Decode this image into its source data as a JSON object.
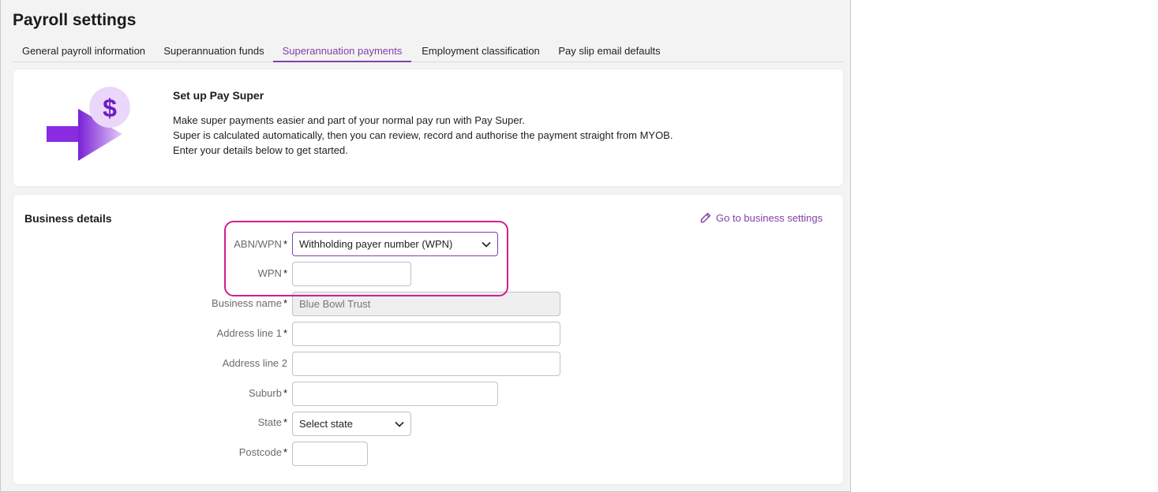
{
  "page": {
    "title": "Payroll settings"
  },
  "tabs": [
    {
      "label": "General payroll information"
    },
    {
      "label": "Superannuation funds"
    },
    {
      "label": "Superannuation payments"
    },
    {
      "label": "Employment classification"
    },
    {
      "label": "Pay slip email defaults"
    }
  ],
  "intro": {
    "icon": "dollar-arrow-icon",
    "title": "Set up Pay Super",
    "lines": [
      "Make super payments easier and part of your normal pay run with Pay Super.",
      "Super is calculated automatically, then you can review, record and authorise the payment straight from MYOB.",
      "Enter your details below to get started."
    ]
  },
  "business": {
    "title": "Business details",
    "link_label": "Go to business settings",
    "fields": {
      "abn_wpn": {
        "label": "ABN/WPN",
        "required": "*",
        "value": "Withholding payer number (WPN)"
      },
      "wpn": {
        "label": "WPN",
        "required": "*",
        "value": ""
      },
      "business_name": {
        "label": "Business name",
        "required": "*",
        "value": "Blue Bowl Trust"
      },
      "address1": {
        "label": "Address line 1",
        "required": "*",
        "value": ""
      },
      "address2": {
        "label": "Address line 2",
        "value": ""
      },
      "suburb": {
        "label": "Suburb",
        "required": "*",
        "value": ""
      },
      "state": {
        "label": "State",
        "required": "*",
        "value": "Select state"
      },
      "postcode": {
        "label": "Postcode",
        "required": "*",
        "value": ""
      }
    }
  },
  "colors": {
    "accent": "#8241aa",
    "highlight": "#d11f8a"
  }
}
